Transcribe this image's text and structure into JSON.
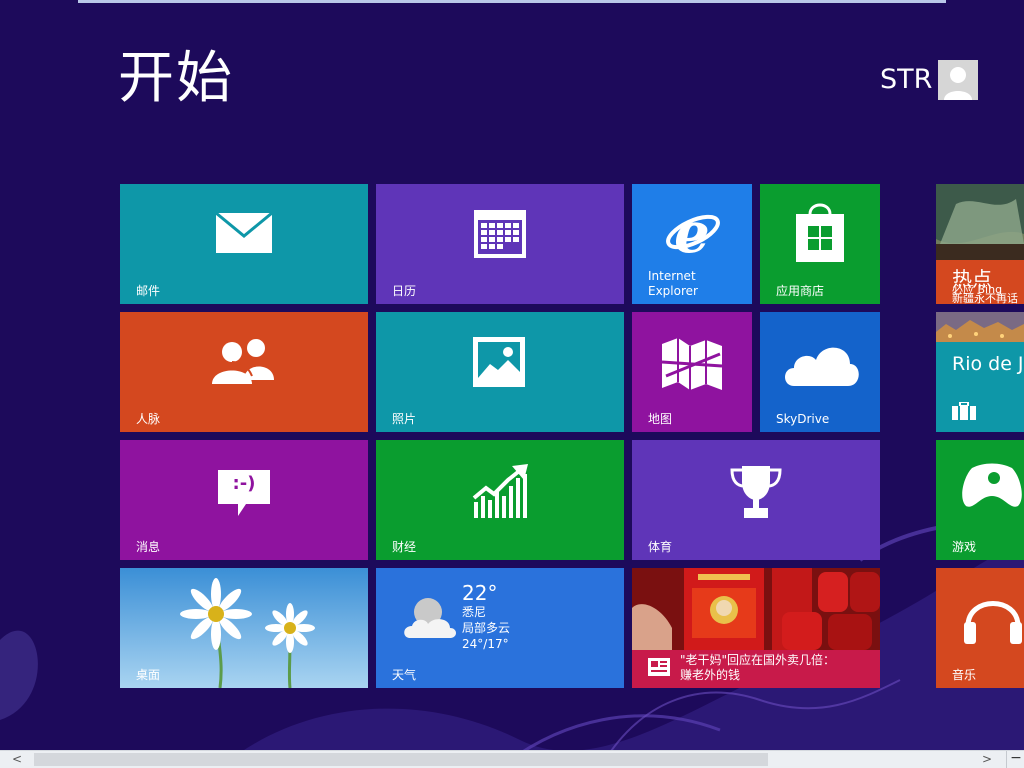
{
  "header": {
    "title": "开始",
    "user": "STR"
  },
  "tiles": {
    "mail": {
      "label": "邮件"
    },
    "calendar": {
      "label": "日历"
    },
    "ie": {
      "label_line1": "Internet",
      "label_line2": "Explorer"
    },
    "store": {
      "label": "应用商店"
    },
    "people": {
      "label": "人脉"
    },
    "photos": {
      "label": "照片"
    },
    "maps": {
      "label": "地图"
    },
    "skydrive": {
      "label": "SkyDrive"
    },
    "messaging": {
      "label": "消息",
      "bubble_text": ":-)"
    },
    "finance": {
      "label": "财经"
    },
    "sports": {
      "label": "体育"
    },
    "desktop": {
      "label": "桌面"
    },
    "weather": {
      "label": "天气",
      "temp": "22°",
      "city": "悉尼",
      "condition": "局部多云",
      "range": "24°/17°"
    },
    "news": {
      "headline_line1": "\"老干妈\"回应在国外卖几倍：",
      "headline_line2": "赚老外的钱"
    },
    "bing": {
      "line1": "热点",
      "line2": "必应 Bing",
      "line3": "新疆永不再话"
    },
    "travel": {
      "label": "Rio de Ja"
    },
    "games": {
      "label": "游戏"
    },
    "music": {
      "label": "音乐"
    }
  },
  "scrollbar": {
    "left_arrow": "<",
    "right_arrow": ">",
    "zoom": "−"
  }
}
